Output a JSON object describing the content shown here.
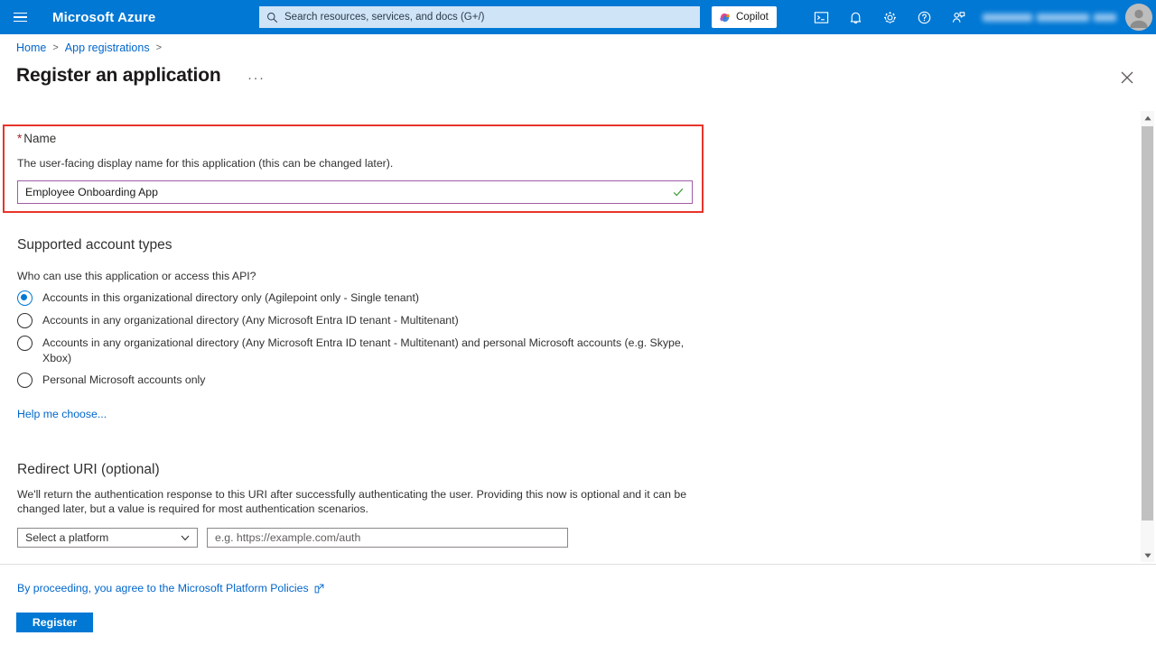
{
  "header": {
    "menu_icon": "hamburger-icon",
    "brand": "Microsoft Azure",
    "search": {
      "icon": "search-icon",
      "placeholder": "Search resources, services, and docs (G+/)"
    },
    "copilot": {
      "label": "Copilot",
      "icon": "copilot-icon"
    },
    "icons": [
      {
        "name": "cloud-shell-icon",
        "title": "Cloud Shell"
      },
      {
        "name": "notifications-bell-icon",
        "title": "Notifications"
      },
      {
        "name": "settings-gear-icon",
        "title": "Settings"
      },
      {
        "name": "help-question-icon",
        "title": "Help"
      },
      {
        "name": "feedback-person-icon",
        "title": "Feedback"
      }
    ],
    "account_blurred": true,
    "avatar": "user-avatar",
    "accent_color": "#0078d4"
  },
  "breadcrumb": {
    "items": [
      "Home",
      "App registrations"
    ],
    "separator": ">"
  },
  "page": {
    "title": "Register an application",
    "more_label": "···",
    "close_icon": "close-icon"
  },
  "name_section": {
    "highlight_color": "#e8342a",
    "required_marker": "*",
    "label": "Name",
    "description": "The user-facing display name for this application (this can be changed later).",
    "input_value": "Employee Onboarding App",
    "input_border_color": "#a05ca8",
    "validation_icon": "checkmark-icon",
    "validation_color": "#3a9b35"
  },
  "account_types": {
    "heading": "Supported account types",
    "question": "Who can use this application or access this API?",
    "options": [
      {
        "label": "Accounts in this organizational directory only (Agilepoint only - Single tenant)",
        "selected": true
      },
      {
        "label": "Accounts in any organizational directory (Any Microsoft Entra ID tenant - Multitenant)",
        "selected": false
      },
      {
        "label": "Accounts in any organizational directory (Any Microsoft Entra ID tenant - Multitenant) and personal Microsoft accounts (e.g. Skype, Xbox)",
        "selected": false
      },
      {
        "label": "Personal Microsoft accounts only",
        "selected": false
      }
    ],
    "help_link": "Help me choose..."
  },
  "redirect_uri": {
    "heading": "Redirect URI (optional)",
    "description": "We'll return the authentication response to this URI after successfully authenticating the user. Providing this now is optional and it can be changed later, but a value is required for most authentication scenarios.",
    "platform_value": "Select a platform",
    "platform_chevron": "chevron-down-icon",
    "uri_placeholder": "e.g. https://example.com/auth"
  },
  "footer": {
    "policy_text": "By proceeding, you agree to the Microsoft Platform Policies",
    "external_icon": "external-link-icon",
    "register_label": "Register",
    "register_color": "#0078d4"
  },
  "scrollbar": {
    "up_icon": "scroll-up-arrow-icon",
    "down_icon": "scroll-down-arrow-icon",
    "thumb": "scroll-thumb"
  }
}
